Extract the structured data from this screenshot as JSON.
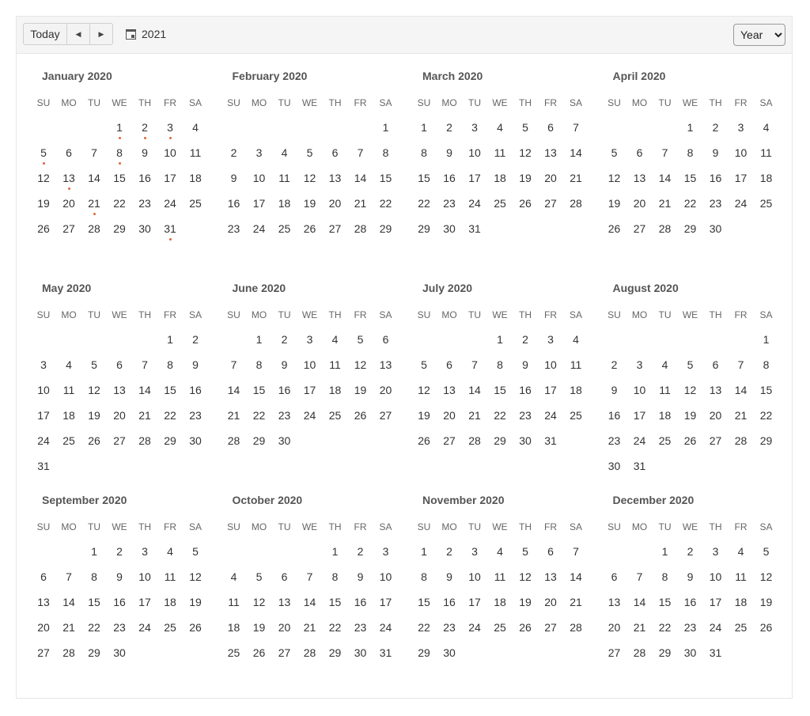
{
  "toolbar": {
    "today_label": "Today",
    "prev_icon": "arrow-left-icon",
    "next_icon": "arrow-right-icon",
    "date_icon": "calendar-icon",
    "date_label": "2021",
    "view_selected": "Year",
    "accent_color": "#e0653b"
  },
  "dow_labels": [
    "SU",
    "MO",
    "TU",
    "WE",
    "TH",
    "FR",
    "SA"
  ],
  "months": [
    {
      "title": "January 2020",
      "start": 3,
      "days": 31,
      "events": [
        1,
        2,
        3,
        5,
        8,
        13,
        21,
        31
      ]
    },
    {
      "title": "February 2020",
      "start": 6,
      "days": 29,
      "events": []
    },
    {
      "title": "March 2020",
      "start": 0,
      "days": 31,
      "events": []
    },
    {
      "title": "April 2020",
      "start": 3,
      "days": 30,
      "events": []
    },
    {
      "title": "May 2020",
      "start": 5,
      "days": 31,
      "events": []
    },
    {
      "title": "June 2020",
      "start": 1,
      "days": 30,
      "events": []
    },
    {
      "title": "July 2020",
      "start": 3,
      "days": 31,
      "events": []
    },
    {
      "title": "August 2020",
      "start": 6,
      "days": 31,
      "events": []
    },
    {
      "title": "September 2020",
      "start": 2,
      "days": 30,
      "events": []
    },
    {
      "title": "October 2020",
      "start": 4,
      "days": 31,
      "events": []
    },
    {
      "title": "November 2020",
      "start": 0,
      "days": 30,
      "events": []
    },
    {
      "title": "December 2020",
      "start": 2,
      "days": 31,
      "events": []
    }
  ]
}
